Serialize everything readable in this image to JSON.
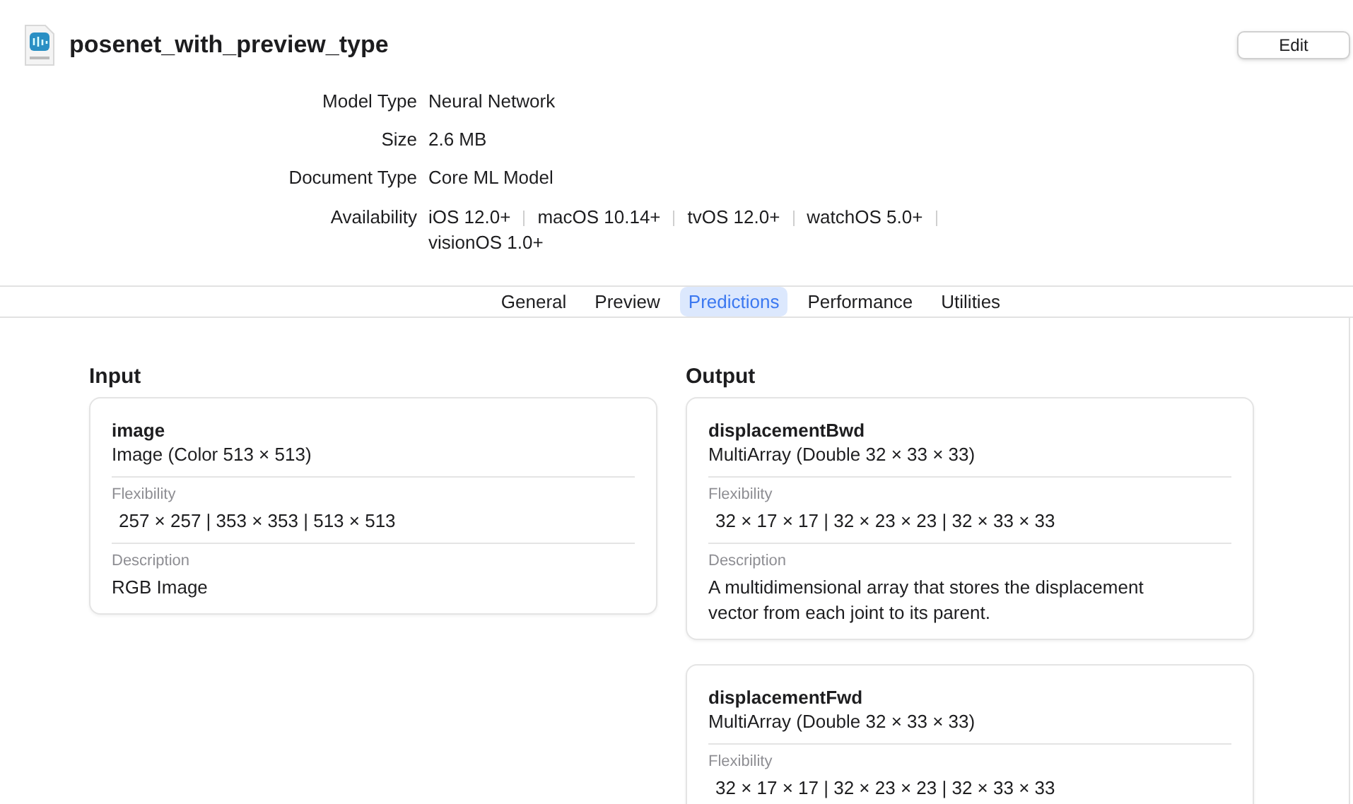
{
  "header": {
    "title": "posenet_with_preview_type",
    "edit_button": "Edit"
  },
  "info": [
    {
      "label": "Model Type",
      "value": "Neural Network"
    },
    {
      "label": "Size",
      "value": "2.6 MB"
    },
    {
      "label": "Document Type",
      "value": "Core ML Model"
    }
  ],
  "availability": {
    "label": "Availability",
    "platforms": [
      "iOS 12.0+",
      "macOS 10.14+",
      "tvOS 12.0+",
      "watchOS 5.0+",
      "visionOS 1.0+"
    ]
  },
  "tabs": [
    {
      "label": "General",
      "selected": false
    },
    {
      "label": "Preview",
      "selected": false
    },
    {
      "label": "Predictions",
      "selected": true
    },
    {
      "label": "Performance",
      "selected": false
    },
    {
      "label": "Utilities",
      "selected": false
    }
  ],
  "columns": [
    {
      "heading": "Input",
      "cards": [
        {
          "name": "image",
          "type": "Image (Color 513 × 513)",
          "sections": [
            {
              "label": "Flexibility",
              "value": "257 × 257 | 353 × 353 | 513 × 513"
            },
            {
              "label": "Description",
              "value": "RGB Image"
            }
          ]
        }
      ]
    },
    {
      "heading": "Output",
      "cards": [
        {
          "name": "displacementBwd",
          "type": "MultiArray (Double 32 × 33 × 33)",
          "sections": [
            {
              "label": "Flexibility",
              "value": "32 × 17 × 17 | 32 × 23 × 23 | 32 × 33 × 33"
            },
            {
              "label": "Description",
              "value": "A multidimensional array that stores the displacement vector from each joint to its parent."
            }
          ]
        },
        {
          "name": "displacementFwd",
          "type": "MultiArray (Double 32 × 33 × 33)",
          "sections": [
            {
              "label": "Flexibility",
              "value": "32 × 17 × 17 | 32 × 23 × 23 | 32 × 33 × 33"
            }
          ]
        }
      ]
    }
  ]
}
